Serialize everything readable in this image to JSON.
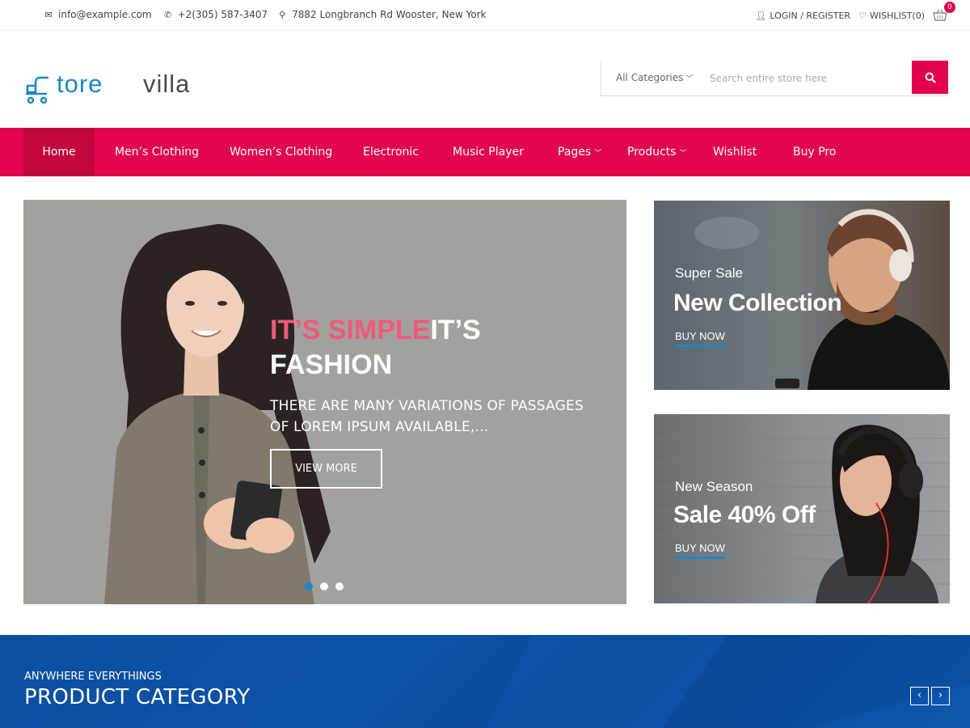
{
  "topbar": {
    "email": "info@example.com",
    "phone": "+2(305) 587-3407",
    "address": "7882 Longbranch Rd Wooster, New York",
    "login": "LOGIN / REGISTER",
    "wishlist": "WISHLIST(0)",
    "cart_count": "0"
  },
  "logo": {
    "part1": "tore",
    "part2": "villa"
  },
  "search": {
    "category": "All Categories",
    "placeholder": "Search entire store here"
  },
  "nav": {
    "items": [
      {
        "label": "Home"
      },
      {
        "label": "Men’s Clothing"
      },
      {
        "label": "Women’s Clothing"
      },
      {
        "label": "Electronic"
      },
      {
        "label": "Music Player"
      },
      {
        "label": "Pages"
      },
      {
        "label": "Products"
      },
      {
        "label": "Wishlist"
      },
      {
        "label": "Buy Pro"
      }
    ]
  },
  "hero": {
    "heading_pink": "IT’S SIMPLE",
    "heading_white_1": "IT’S",
    "heading_white_2": "FASHION",
    "subtitle": "THERE ARE MANY VARIATIONS OF PASSAGES OF LOREM IPSUM AVAILABLE,...",
    "button": "VIEW MORE",
    "active_slide": 1,
    "slide_count": 3
  },
  "promos": [
    {
      "small": "Super Sale",
      "big": "New Collection",
      "link": "BUY NOW"
    },
    {
      "small": "New Season",
      "big": "Sale 40% Off",
      "link": "BUY NOW"
    }
  ],
  "category_section": {
    "eyebrow": "ANYWHERE EVERYTHINGS",
    "title": "PRODUCT CATEGORY"
  },
  "colors": {
    "accent": "#e0074f",
    "brand_blue": "#1e87c7",
    "band_blue": "#0b4fa0"
  }
}
